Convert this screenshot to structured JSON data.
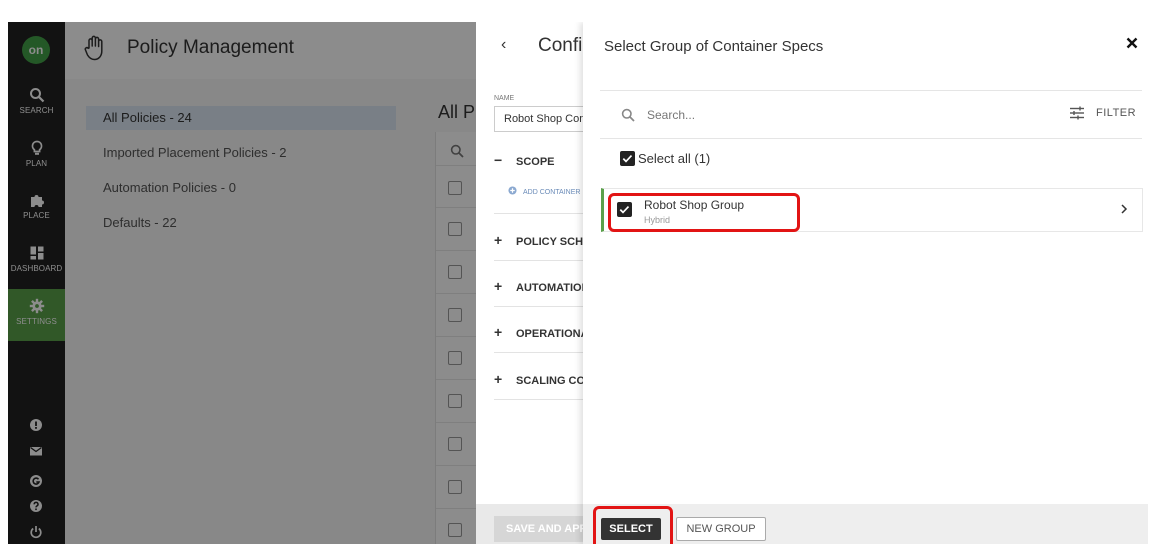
{
  "colors": {
    "sidebar": "#222222",
    "accent": "#5aa14a",
    "highlight": "#e21414",
    "primary_button": "#333333"
  },
  "sidebar": {
    "logo": "on",
    "items": [
      {
        "label": "SEARCH",
        "icon": "search-icon"
      },
      {
        "label": "PLAN",
        "icon": "lightbulb-icon"
      },
      {
        "label": "PLACE",
        "icon": "puzzle-icon"
      },
      {
        "label": "DASHBOARD",
        "icon": "dashboard-icon"
      },
      {
        "label": "SETTINGS",
        "icon": "gear-icon",
        "active": true
      }
    ],
    "bottom_icons": [
      "alert-icon",
      "mail-icon",
      "g-icon",
      "help-icon",
      "power-icon"
    ]
  },
  "header": {
    "title": "Policy Management",
    "icon": "hand-icon"
  },
  "policies": {
    "items": [
      {
        "label": "All Policies - 24",
        "active": true
      },
      {
        "label": "Imported Placement Policies - 2"
      },
      {
        "label": "Automation Policies - 0"
      },
      {
        "label": "Defaults - 22"
      }
    ],
    "list_title": "All P"
  },
  "config": {
    "title": "Confi",
    "name_label": "NAME",
    "name_value": "Robot Shop Cont",
    "sections": [
      {
        "sign": "−",
        "label": "SCOPE"
      },
      {
        "sign": "+",
        "label": "POLICY SCHE"
      },
      {
        "sign": "+",
        "label": "AUTOMATION"
      },
      {
        "sign": "+",
        "label": "OPERATIONA"
      },
      {
        "sign": "+",
        "label": "SCALING CO"
      }
    ],
    "add_container": "ADD CONTAINER",
    "save_apply": "SAVE AND APPL"
  },
  "panel": {
    "title": "Select Group of Container Specs",
    "search_placeholder": "Search...",
    "filter_label": "FILTER",
    "select_all": "Select all (1)",
    "group": {
      "name": "Robot Shop Group",
      "type": "Hybrid",
      "checked": true
    },
    "select_button": "SELECT",
    "new_group_button": "NEW GROUP"
  }
}
